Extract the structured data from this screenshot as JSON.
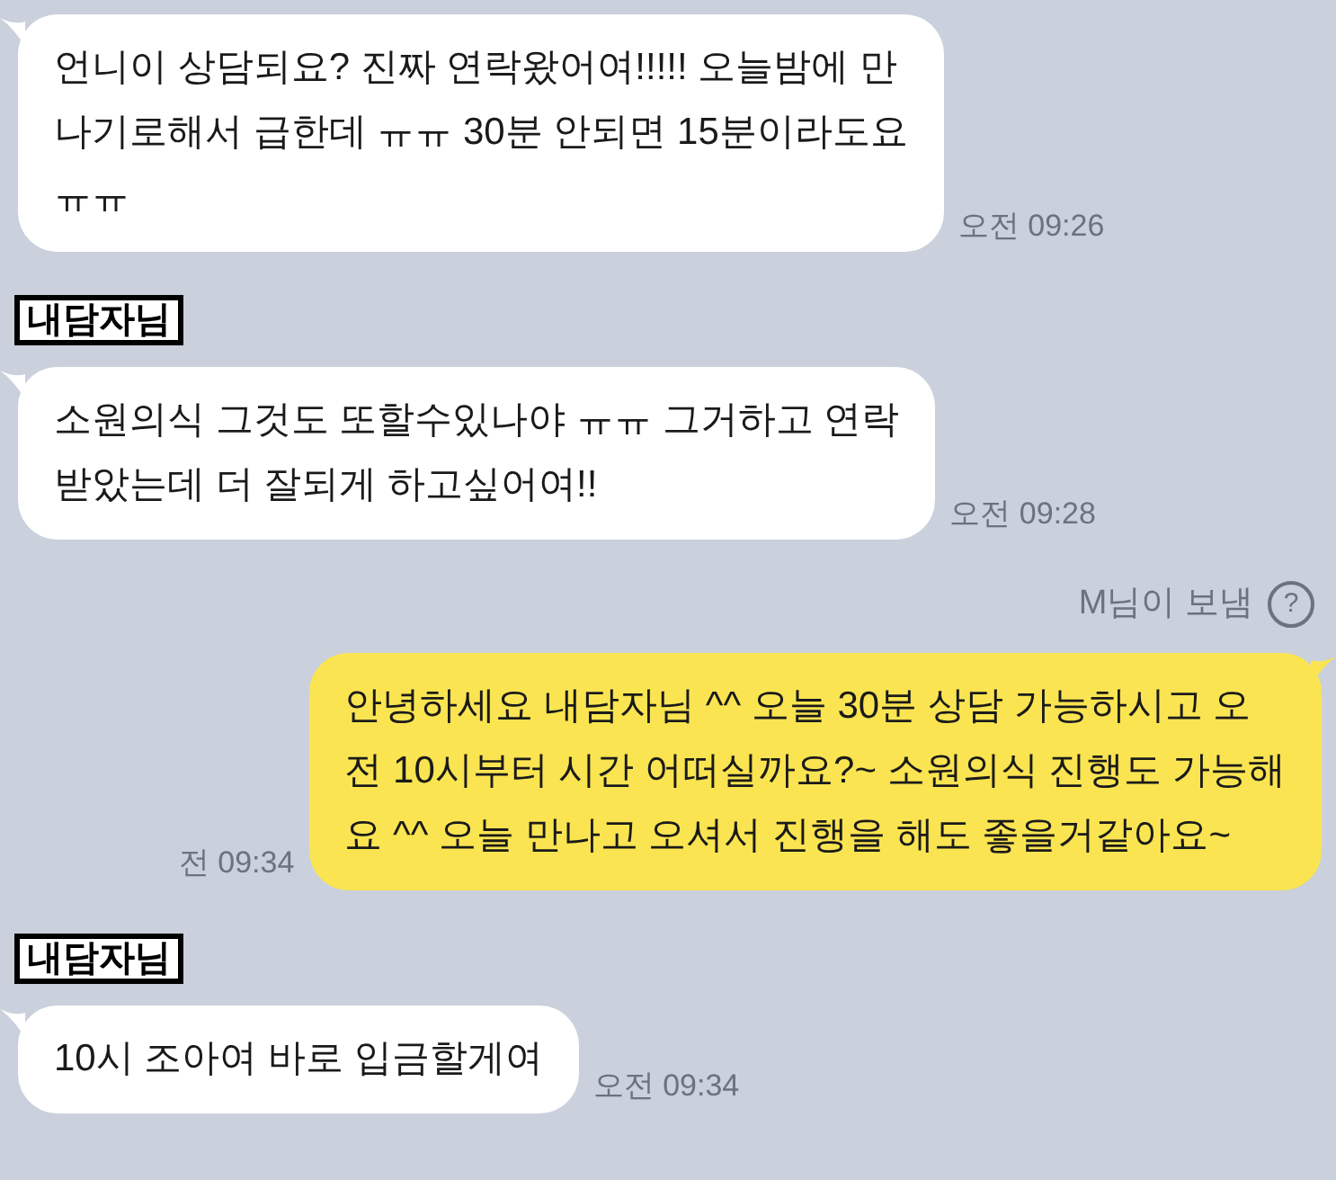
{
  "messages": [
    {
      "kind": "received",
      "lines": [
        "언니이 상담되요? 진짜 연락왔어여!!!!! 오늘밤에 만",
        "나기로해서 급한데 ㅠㅠ 30분 안되면 15분이라도요",
        "ㅠㅠ"
      ],
      "time": "오전 09:26"
    },
    {
      "kind": "sender",
      "name": "내담자님"
    },
    {
      "kind": "received",
      "lines": [
        "소원의식 그것도 또할수있나야 ㅠㅠ 그거하고 연락",
        "받았는데 더 잘되게 하고싶어여!!"
      ],
      "time": "오전 09:28"
    },
    {
      "kind": "sent_note",
      "text": "M님이 보냄",
      "help": "?"
    },
    {
      "kind": "sent",
      "lines": [
        "안녕하세요 내담자님 ^^ 오늘 30분 상담 가능하시고 오",
        "전 10시부터 시간 어떠실까요?~ 소원의식 진행도 가능해",
        "요 ^^ 오늘 만나고 오셔서 진행을 해도 좋을거같아요~"
      ],
      "time": "전 09:34"
    },
    {
      "kind": "sender",
      "name": "내담자님"
    },
    {
      "kind": "received",
      "lines": [
        "10시 조아여 바로 입금할게여"
      ],
      "time": "오전 09:34"
    }
  ]
}
